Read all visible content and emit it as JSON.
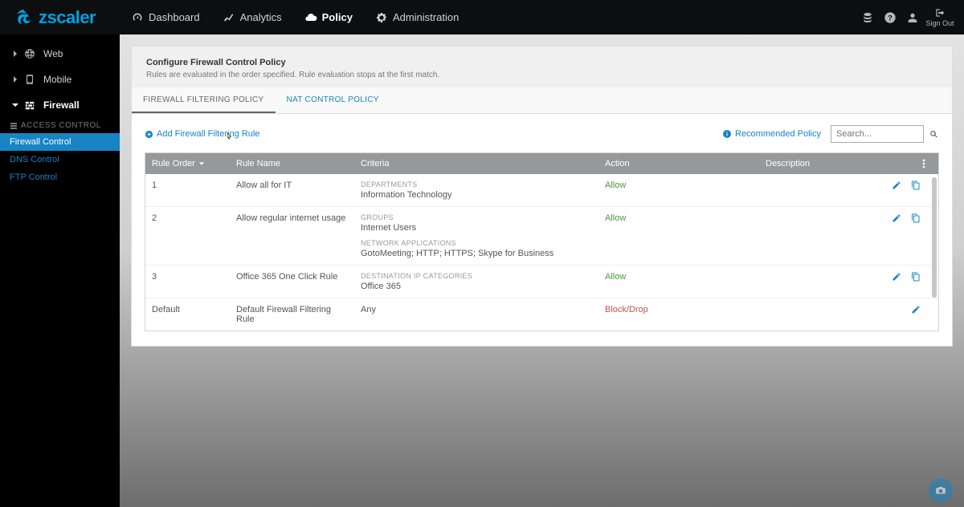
{
  "brand": "zscaler",
  "topnav": {
    "dashboard": "Dashboard",
    "analytics": "Analytics",
    "policy": "Policy",
    "administration": "Administration"
  },
  "signout_label": "Sign Out",
  "sidebar": {
    "items": [
      {
        "label": "Web"
      },
      {
        "label": "Mobile"
      },
      {
        "label": "Firewall"
      }
    ],
    "section_heading": "ACCESS CONTROL",
    "submenu": [
      {
        "label": "Firewall Control",
        "selected": true
      },
      {
        "label": "DNS Control",
        "selected": false
      },
      {
        "label": "FTP Control",
        "selected": false
      }
    ]
  },
  "panel": {
    "title": "Configure Firewall Control Policy",
    "subtitle": "Rules are evaluated in the order specified. Rule evaluation stops at the first match."
  },
  "tabs": [
    {
      "label": "FIREWALL FILTERING POLICY",
      "active": true
    },
    {
      "label": "NAT CONTROL POLICY",
      "active": false
    }
  ],
  "toolbar": {
    "add_rule": "Add Firewall Filtering Rule",
    "recommended": "Recommended Policy",
    "search_placeholder": "Search..."
  },
  "grid": {
    "headers": {
      "order": "Rule Order",
      "name": "Rule Name",
      "criteria": "Criteria",
      "action": "Action",
      "description": "Description"
    },
    "rows": [
      {
        "order": "1",
        "name": "Allow all for IT",
        "criteria": [
          {
            "label": "DEPARTMENTS",
            "value": "Information Technology"
          }
        ],
        "action": "Allow",
        "action_class": "action-allow",
        "can_copy": true
      },
      {
        "order": "2",
        "name": "Allow regular internet usage",
        "criteria": [
          {
            "label": "GROUPS",
            "value": "Internet Users"
          },
          {
            "label": "NETWORK APPLICATIONS",
            "value": "GotoMeeting; HTTP; HTTPS; Skype for Business"
          }
        ],
        "action": "Allow",
        "action_class": "action-allow",
        "can_copy": true
      },
      {
        "order": "3",
        "name": "Office 365 One Click Rule",
        "criteria": [
          {
            "label": "DESTINATION IP CATEGORIES",
            "value": "Office 365"
          }
        ],
        "action": "Allow",
        "action_class": "action-allow",
        "can_copy": true
      },
      {
        "order": "Default",
        "name": "Default Firewall Filtering Rule",
        "criteria": [
          {
            "label": "",
            "value": "Any"
          }
        ],
        "action": "Block/Drop",
        "action_class": "action-block",
        "can_copy": false
      }
    ]
  }
}
